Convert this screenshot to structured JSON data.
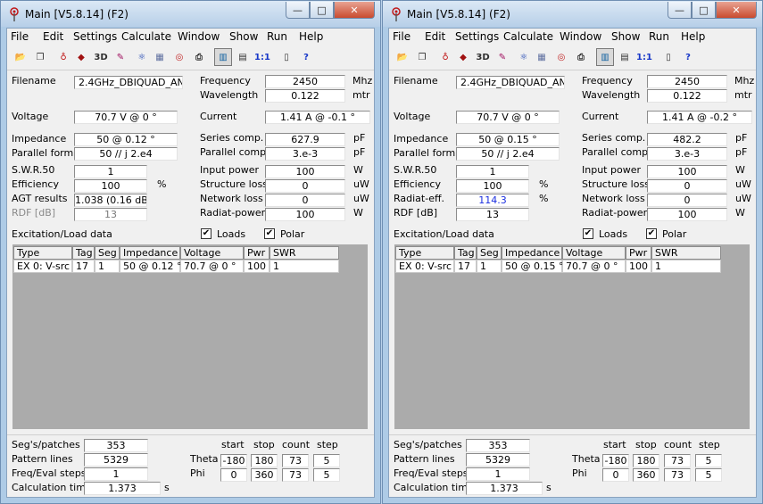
{
  "windows": [
    {
      "title": "Main [V5.8.14]  (F2)",
      "menu": [
        "File",
        "Edit",
        "Settings",
        "Calculate",
        "Window",
        "Show",
        "Run",
        "Help"
      ],
      "filename": "2.4GHz_DBIQUAD_ANT",
      "frequency": "2450",
      "frequency_unit": "Mhz",
      "wavelength": "0.122",
      "wavelength_unit": "mtr",
      "voltage": "70.7 V @ 0 °",
      "current": "1.41 A @ -0.1 °",
      "impedance": "50 @ 0.12 °",
      "parallel_form": "50 // j 2.e4",
      "series_comp": "627.9",
      "parallel_comp": "3.e-3",
      "swr": "1",
      "efficiency": "100",
      "row3_label": "AGT results",
      "row3_value": "1.038  (0.16 dB)",
      "row3_unit": "",
      "row3_blue": false,
      "rdf_label": "RDF [dB]",
      "rdf_value": "13",
      "rdf_disabled": true,
      "input_power": "100",
      "structure_loss": "0",
      "network_loss": "0",
      "radiat_power": "100",
      "table": {
        "type": "EX 0: V-src",
        "tag": "17",
        "seg": "1",
        "impedance": "50 @ 0.12 °",
        "voltage": "70.7 @ 0 °",
        "pwr": "100",
        "swr": "1"
      },
      "segs_patches": "353",
      "pattern_lines": "5329",
      "freq_eval_steps": "1",
      "calc_time": "1.373"
    },
    {
      "title": "Main [V5.8.14]  (F2)",
      "menu": [
        "File",
        "Edit",
        "Settings",
        "Calculate",
        "Window",
        "Show",
        "Run",
        "Help"
      ],
      "filename": "2.4GHz_DBIQUAD_ANT",
      "frequency": "2450",
      "frequency_unit": "Mhz",
      "wavelength": "0.122",
      "wavelength_unit": "mtr",
      "voltage": "70.7 V @ 0 °",
      "current": "1.41 A @ -0.2 °",
      "impedance": "50 @ 0.15 °",
      "parallel_form": "50 // j 2.e4",
      "series_comp": "482.2",
      "parallel_comp": "3.e-3",
      "swr": "1",
      "efficiency": "100",
      "row3_label": "Radiat-eff.",
      "row3_value": "114.3",
      "row3_unit": "%",
      "row3_blue": true,
      "rdf_label": "RDF [dB]",
      "rdf_value": "13",
      "rdf_disabled": false,
      "input_power": "100",
      "structure_loss": "0",
      "network_loss": "0",
      "radiat_power": "100",
      "table": {
        "type": "EX 0: V-src",
        "tag": "17",
        "seg": "1",
        "impedance": "50 @ 0.15 °",
        "voltage": "70.7 @ 0 °",
        "pwr": "100",
        "swr": "1"
      },
      "segs_patches": "353",
      "pattern_lines": "5329",
      "freq_eval_steps": "1",
      "calc_time": "1.373"
    }
  ],
  "labels": {
    "filename": "Filename",
    "frequency": "Frequency",
    "wavelength": "Wavelength",
    "voltage": "Voltage",
    "current": "Current",
    "impedance": "Impedance",
    "series_comp": "Series comp.",
    "parallel_form": "Parallel form",
    "parallel_comp": "Parallel comp.",
    "swr": "S.W.R.50",
    "input_power": "Input power",
    "efficiency": "Efficiency",
    "structure_loss": "Structure loss",
    "network_loss": "Network loss",
    "radiat_power": "Radiat-power",
    "excitation": "Excitation/Load data",
    "loads": "Loads",
    "polar": "Polar",
    "pf_unit": "pF",
    "w_unit": "W",
    "uw_unit": "uW",
    "pct": "%",
    "segs": "Seg's/patches",
    "pattern": "Pattern lines",
    "freqeval": "Freq/Eval steps",
    "calctime": "Calculation time",
    "sec": "s",
    "start": "start",
    "stop": "stop",
    "count": "count",
    "step": "step",
    "theta": "Theta",
    "phi": "Phi",
    "col_type": "Type",
    "col_tag": "Tag",
    "col_seg": "Seg",
    "col_impedance": "Impedance",
    "col_voltage": "Voltage",
    "col_pwr": "Pwr",
    "col_swr": "SWR",
    "check": "✔",
    "min": "—",
    "max": "□",
    "close": "✕"
  },
  "pattern": {
    "theta": {
      "start": "-180",
      "stop": "180",
      "count": "73",
      "step": "5"
    },
    "phi": {
      "start": "0",
      "stop": "360",
      "count": "73",
      "step": "5"
    }
  },
  "colors": {
    "blue_value": "#1a2ee0",
    "title_bg": "#b9d1ea",
    "close_btn": "#c94b2f"
  },
  "toolbar_icons": [
    "open-folder-icon",
    "windows-icon",
    "antenna-icon",
    "cube-icon",
    "3d-icon",
    "edit-icon",
    "atom-icon",
    "pattern-icon",
    "target-icon",
    "print-icon",
    "gain-table-icon",
    "grid-icon",
    "one-to-one-icon",
    "book-icon",
    "help-icon"
  ]
}
